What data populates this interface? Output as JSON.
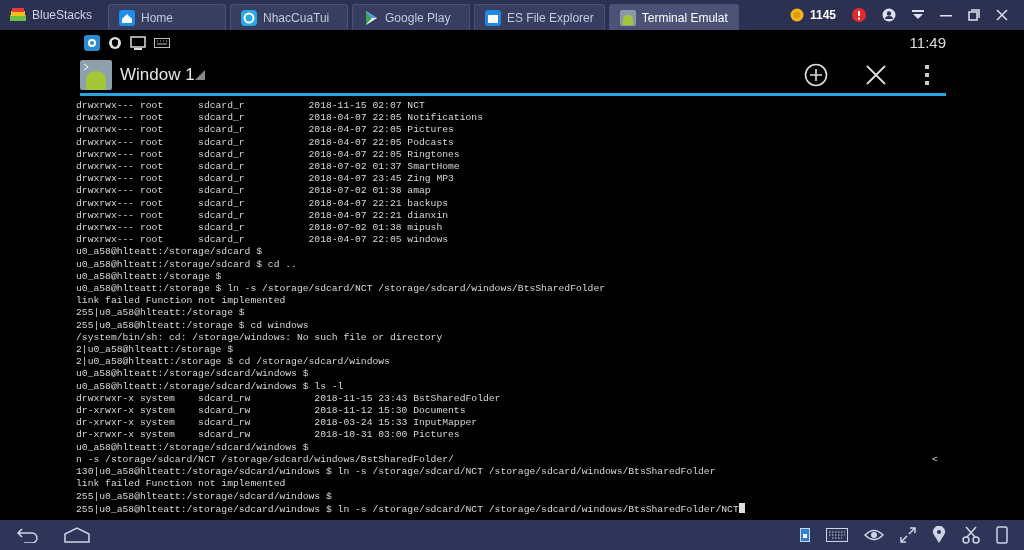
{
  "app_bar": {
    "brand": "BlueStacks",
    "coins": "1145",
    "tabs": [
      {
        "label": "Home",
        "selected": false
      },
      {
        "label": "NhacCuaTui",
        "selected": false
      },
      {
        "label": "Google Play",
        "selected": false
      },
      {
        "label": "ES File Explorer",
        "selected": false
      },
      {
        "label": "Terminal Emulat",
        "selected": true
      }
    ]
  },
  "status_bar": {
    "time": "11:49"
  },
  "action_bar": {
    "title": "Window 1"
  },
  "terminal": {
    "cursor": true,
    "lines": [
      {
        "text": "drwxrwx--- root      sdcard_r           2018-11-15 02:07 NCT"
      },
      {
        "text": "drwxrwx--- root      sdcard_r           2018-04-07 22:05 Notifications"
      },
      {
        "text": "drwxrwx--- root      sdcard_r           2018-04-07 22:05 Pictures"
      },
      {
        "text": "drwxrwx--- root      sdcard_r           2018-04-07 22:05 Podcasts"
      },
      {
        "text": "drwxrwx--- root      sdcard_r           2018-04-07 22:05 Ringtones"
      },
      {
        "text": "drwxrwx--- root      sdcard_r           2018-07-02 01:37 SmartHome"
      },
      {
        "text": "drwxrwx--- root      sdcard_r           2018-04-07 23:45 Zing MP3"
      },
      {
        "text": "drwxrwx--- root      sdcard_r           2018-07-02 01:38 amap"
      },
      {
        "text": "drwxrwx--- root      sdcard_r           2018-04-07 22:21 backups"
      },
      {
        "text": "drwxrwx--- root      sdcard_r           2018-04-07 22:21 dianxin"
      },
      {
        "text": "drwxrwx--- root      sdcard_r           2018-07-02 01:38 mipush"
      },
      {
        "text": "drwxrwx--- root      sdcard_r           2018-04-07 22:05 windows"
      },
      {
        "text": "u0_a58@hlteatt:/storage/sdcard $"
      },
      {
        "text": "u0_a58@hlteatt:/storage/sdcard $ cd .."
      },
      {
        "text": "u0_a58@hlteatt:/storage $"
      },
      {
        "text": "u0_a58@hlteatt:/storage $ ln -s /storage/sdcard/NCT /storage/sdcard/windows/BtsSharedFolder"
      },
      {
        "text": "link failed Function not implemented"
      },
      {
        "text": "255|u0_a58@hlteatt:/storage $"
      },
      {
        "text": "255|u0_a58@hlteatt:/storage $ cd windows"
      },
      {
        "text": "/system/bin/sh: cd: /storage/windows: No such file or directory"
      },
      {
        "text": "2|u0_a58@hlteatt:/storage $"
      },
      {
        "text": "2|u0_a58@hlteatt:/storage $ cd /storage/sdcard/windows"
      },
      {
        "text": "u0_a58@hlteatt:/storage/sdcard/windows $"
      },
      {
        "text": "u0_a58@hlteatt:/storage/sdcard/windows $ ls -l"
      },
      {
        "text": "drwxrwxr-x system    sdcard_rw           2018-11-15 23:43 BstSharedFolder"
      },
      {
        "text": "dr-xrwxr-x system    sdcard_rw           2018-11-12 15:30 Documents"
      },
      {
        "text": "dr-xrwxr-x system    sdcard_rw           2018-03-24 15:33 InputMapper"
      },
      {
        "text": "dr-xrwxr-x system    sdcard_rw           2018-10-31 03:00 Pictures"
      },
      {
        "text": "u0_a58@hlteatt:/storage/sdcard/windows $"
      },
      {
        "text": "n -s /storage/sdcard/NCT /storage/sdcard/windows/BstSharedFolder/",
        "end": "<"
      },
      {
        "text": "130|u0_a58@hlteatt:/storage/sdcard/windows $ ln -s /storage/sdcard/NCT /storage/sdcard/windows/BtsSharedFolder"
      },
      {
        "text": "link failed Function not implemented"
      },
      {
        "text": "255|u0_a58@hlteatt:/storage/sdcard/windows $"
      },
      {
        "text": "255|u0_a58@hlteatt:/storage/sdcard/windows $ ln -s /storage/sdcard/NCT /storage/sdcard/windows/BtsSharedFolder/NCT"
      }
    ]
  }
}
